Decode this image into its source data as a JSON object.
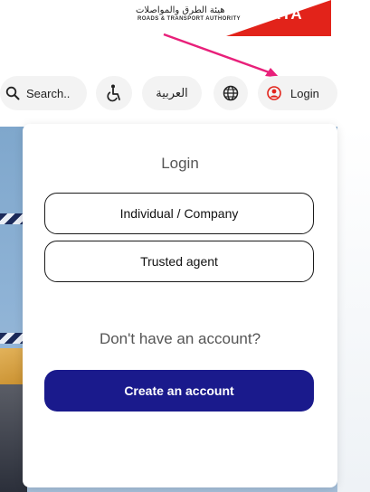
{
  "header": {
    "logo_arabic": "هيئة الطرق والمواصلات",
    "logo_english": "ROADS & TRANSPORT AUTHORITY",
    "logo_mark": "RTA",
    "search_label": "Search..",
    "arabic_label": "العربية",
    "login_label": "Login",
    "icons": {
      "search": "search-icon",
      "accessibility": "accessibility-icon",
      "globe": "globe-icon",
      "user": "user-icon"
    }
  },
  "login_popup": {
    "title": "Login",
    "options": [
      "Individual / Company",
      "Trusted agent"
    ],
    "no_account_text": "Don't have an account?",
    "create_account_label": "Create an account"
  },
  "colors": {
    "brand_red": "#e2231a",
    "primary_blue": "#1a1a8c",
    "annotation_arrow": "#e8207a"
  }
}
